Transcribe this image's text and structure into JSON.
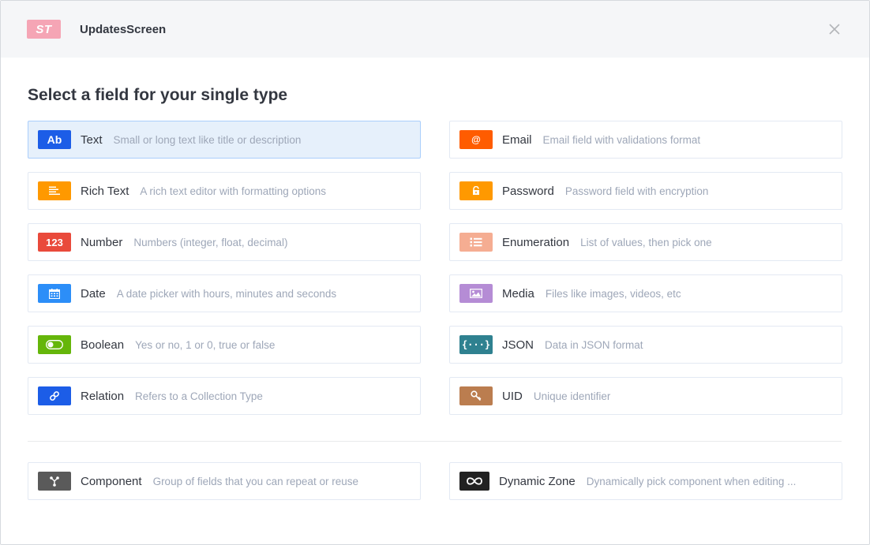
{
  "header": {
    "badge": "ST",
    "title": "UpdatesScreen"
  },
  "section_title": "Select a field for your single type",
  "fields_left": [
    {
      "label": "Text",
      "desc": "Small or long text like title or description",
      "icon": "text-ab-icon",
      "icon_text": "Ab",
      "color": "#1c5de7"
    },
    {
      "label": "Rich Text",
      "desc": "A rich text editor with formatting options",
      "icon": "rich-text-icon",
      "icon_text": "",
      "color": "#ff9900"
    },
    {
      "label": "Number",
      "desc": "Numbers (integer, float, decimal)",
      "icon": "number-123-icon",
      "icon_text": "123",
      "color": "#e94a3b"
    },
    {
      "label": "Date",
      "desc": "A date picker with hours, minutes and seconds",
      "icon": "calendar-icon",
      "icon_text": "",
      "color": "#2c8ef8"
    },
    {
      "label": "Boolean",
      "desc": "Yes or no, 1 or 0, true or false",
      "icon": "toggle-icon",
      "icon_text": "",
      "color": "#65b60a"
    },
    {
      "label": "Relation",
      "desc": "Refers to a Collection Type",
      "icon": "link-icon",
      "icon_text": "",
      "color": "#1c5de7"
    }
  ],
  "fields_right": [
    {
      "label": "Email",
      "desc": "Email field with validations format",
      "icon": "at-icon",
      "icon_text": "@",
      "color": "#ff5c00"
    },
    {
      "label": "Password",
      "desc": "Password field with encryption",
      "icon": "lock-icon",
      "icon_text": "",
      "color": "#ff9900"
    },
    {
      "label": "Enumeration",
      "desc": "List of values, then pick one",
      "icon": "list-icon",
      "icon_text": "",
      "color": "#f5ad92"
    },
    {
      "label": "Media",
      "desc": "Files like images, videos, etc",
      "icon": "image-icon",
      "icon_text": "",
      "color": "#b58cd5"
    },
    {
      "label": "JSON",
      "desc": "Data in JSON format",
      "icon": "json-braces-icon",
      "icon_text": "{···}",
      "color": "#2f8190"
    },
    {
      "label": "UID",
      "desc": "Unique identifier",
      "icon": "key-icon",
      "icon_text": "",
      "color": "#bb7d4f"
    }
  ],
  "bottom_fields": [
    {
      "label": "Component",
      "desc": "Group of fields that you can repeat or reuse",
      "icon": "component-icon",
      "color": "#5a5a5a"
    },
    {
      "label": "Dynamic Zone",
      "desc": "Dynamically pick component when editing ...",
      "icon": "infinity-icon",
      "color": "#222222"
    }
  ]
}
